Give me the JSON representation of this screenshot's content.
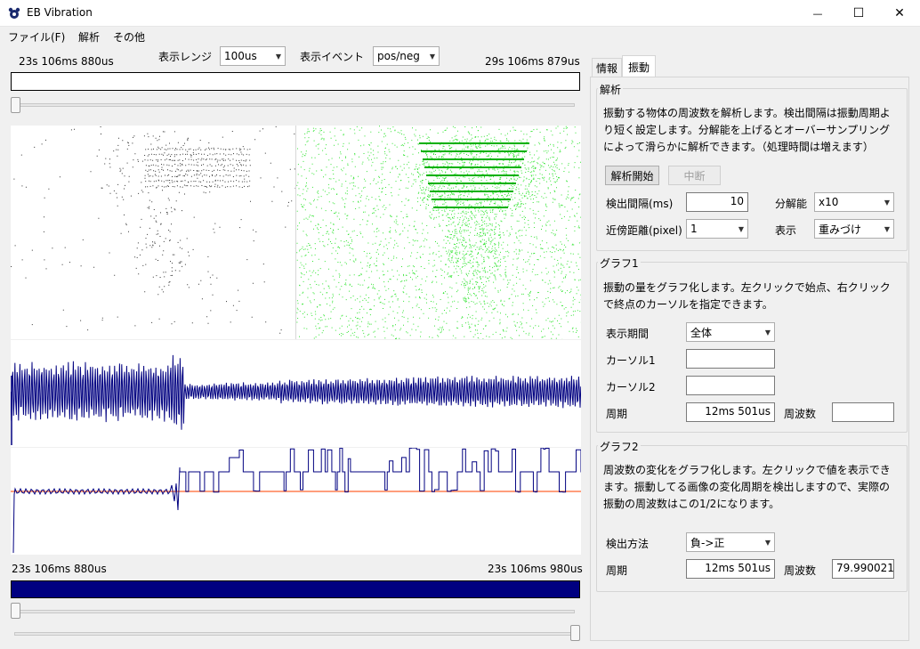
{
  "window": {
    "title": "EB Vibration",
    "minimize_glyph": "—",
    "maximize_glyph": "☐",
    "close_glyph": "✕"
  },
  "menu": [
    "ファイル(F)",
    "解析",
    "その他"
  ],
  "top": {
    "start_time": "23s 106ms 880us",
    "end_time": "29s 106ms 879us",
    "range_label": "表示レンジ",
    "range_value": "100us",
    "event_label": "表示イベント",
    "event_value": "pos/neg"
  },
  "bottom": {
    "start_time": "23s 106ms 880us",
    "end_time": "23s 106ms 980us"
  },
  "tabs": [
    "情報",
    "振動"
  ],
  "analysis": {
    "title": "解析",
    "description": "振動する物体の周波数を解析します。検出間隔は振動周期より短く設定します。分解能を上げるとオーバーサンプリングによって滑らかに解析できます。（処理時間は増えます）",
    "start_button": "解析開始",
    "stop_button": "中断",
    "interval_label": "検出間隔(ms)",
    "interval_value": "10",
    "resolution_label": "分解能",
    "resolution_value": "x10",
    "distance_label": "近傍距離(pixel)",
    "distance_value": "1",
    "display_label": "表示",
    "display_value": "重みづけ"
  },
  "graph1": {
    "title": "グラフ1",
    "description": "振動の量をグラフ化します。左クリックで始点、右クリックで終点のカーソルを指定できます。",
    "period_label": "表示期間",
    "period_value": "全体",
    "cursor1_label": "カーソル1",
    "cursor1_value": "",
    "cursor2_label": "カーソル2",
    "cursor2_value": "",
    "cycle_label": "周期",
    "cycle_value": "12ms 501us",
    "freq_label": "周波数",
    "freq_value": ""
  },
  "graph2": {
    "title": "グラフ2",
    "description": "周波数の変化をグラフ化します。左クリックで値を表示できます。振動してる画像の変化周期を検出しますので、実際の振動の周波数はこの1/2になります。",
    "method_label": "検出方法",
    "method_value": "負->正",
    "cycle_label": "周期",
    "cycle_value": "12ms 501us",
    "freq_label": "周波数",
    "freq_value": "79.990021"
  },
  "colors": {
    "waveform": "#000080",
    "event_dots": "#00dd00",
    "threshold_line": "#ff7f50",
    "progress_fill": "#000080"
  }
}
